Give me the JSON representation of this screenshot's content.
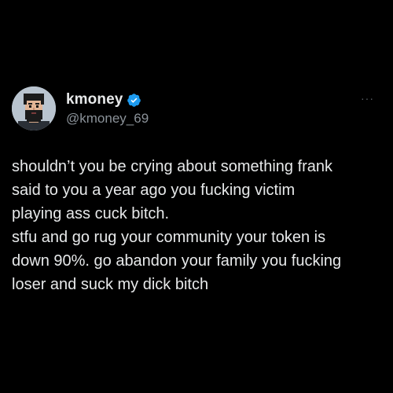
{
  "tweet": {
    "author": {
      "display_name": "kmoney",
      "handle": "@kmoney_69",
      "verified": true,
      "avatar_icon": "pixel-art-bearded-man-avatar"
    },
    "more_options_label": "···",
    "body_lines": [
      "shouldn’t you be crying about something frank",
      "said to you a year ago you fucking victim",
      "playing ass cuck bitch.",
      "stfu and go rug your community your token is",
      "down 90%. go abandon your family you fucking",
      "loser and suck my dick bitch"
    ]
  },
  "colors": {
    "background": "#000000",
    "text_primary": "#e7e9ea",
    "text_secondary": "#8b9299",
    "verified_badge": "#1d9bf0"
  }
}
